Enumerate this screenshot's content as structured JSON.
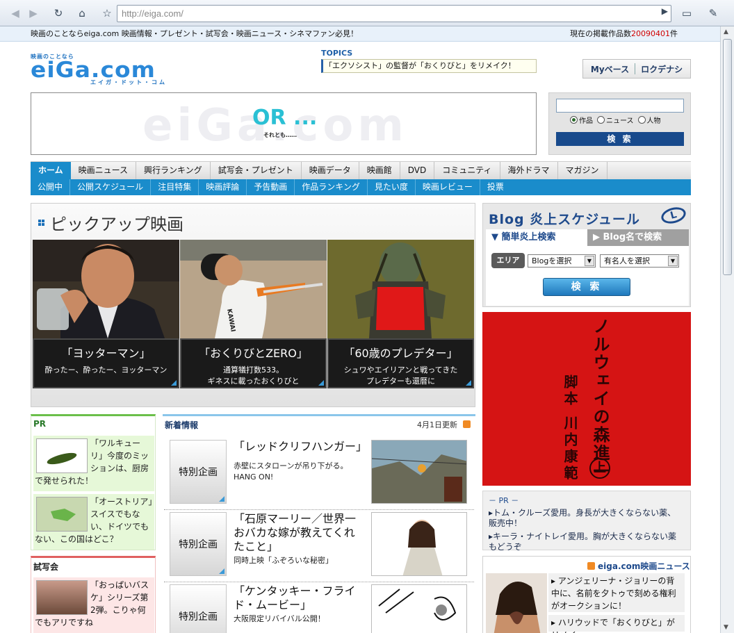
{
  "browser": {
    "url": "http://eiga.com/",
    "back_icon": "back-arrow-icon",
    "forward_icon": "forward-arrow-icon"
  },
  "infobar": {
    "left": "映画のことならeiga.com 映画情報・プレゼント・試写会・映画ニュース・シネマファン必見！",
    "right_prefix": "現在の掲載作品数",
    "right_value": "20090401",
    "right_suffix": "件"
  },
  "logo": {
    "top": "映画のことなら",
    "main": "eiGa.com",
    "sub": "エイガ・ドット・コム"
  },
  "topics": {
    "label": "TOPICS",
    "text": "「エクソシスト」の監督が「おくりびと」をリメイク！"
  },
  "user": {
    "mybase": "Myベース",
    "login": "ロクデナシ"
  },
  "banner": {
    "ghost": "eiGa.com",
    "main": "OR ...",
    "sub": "それとも……"
  },
  "search": {
    "opt1": "作品",
    "opt2": "ニュース",
    "opt3": "人物",
    "button": "検 索"
  },
  "mainnav": [
    "ホーム",
    "映画ニュース",
    "興行ランキング",
    "試写会・プレゼント",
    "映画データ",
    "映画館",
    "DVD",
    "コミュニティ",
    "海外ドラマ",
    "マガジン"
  ],
  "subnav": [
    "公開中",
    "公開スケジュール",
    "注目特集",
    "映画評論",
    "予告動画",
    "作品ランキング",
    "見たい度",
    "映画レビュー",
    "投票"
  ],
  "pickup": {
    "title": "ピックアップ映画",
    "cards": [
      {
        "title": "「ヨッターマン」",
        "line1": "酔ったー、酔ったー、ヨッターマン",
        "line2": ""
      },
      {
        "title": "「おくりびとZERO」",
        "line1": "通算犠打数533。",
        "line2": "ギネスに載ったおくりびと"
      },
      {
        "title": "「60歳のプレデター」",
        "line1": "シュワやエイリアンと戦ってきた",
        "line2": "プレデターも還暦に"
      }
    ],
    "card2_jersey": "KAWAI"
  },
  "pr": {
    "title": "PR",
    "items": [
      {
        "text": "「ワルキューリ」今度のミッションは、厨房で発せられた！"
      },
      {
        "text": "「オーストリア」スイスでもない、ドイツでもない、この国はどこ？"
      }
    ]
  },
  "shisha": {
    "title": "試写会",
    "text": "「おっぱいバスケ」シリーズ第2弾。こりゃ何でもアリですね"
  },
  "news": {
    "title": "新着情報",
    "updated": "4月1日更新",
    "items": [
      {
        "tag": "特別企画",
        "title": "「レッドクリフハンガー」",
        "desc": "赤壁にスタローンが吊り下がる。HANG ON!"
      },
      {
        "tag": "特別企画",
        "title": "「石原マーリー／世界一おバカな嫁が教えてくれたこと」",
        "desc": "同時上映「ふぞろいな秘密」"
      },
      {
        "tag": "特別企画",
        "title": "「ケンタッキー・フライド・ムービー」",
        "desc": "大阪限定リバイバル公開！"
      }
    ]
  },
  "blog": {
    "title": "Blog 炎上スケジュール",
    "tab1": "▼ 簡単炎上検索",
    "tab2": "▶ Blog名で検索",
    "area": "エリア",
    "select1": "Blogを選択",
    "select2": "有名人を選択",
    "button": "検 索"
  },
  "redad": {
    "line1": "ノルウェイの森進一",
    "circle": "上",
    "line2": "脚本 川内康範"
  },
  "pr2": {
    "title": "－ PR －",
    "items": [
      "トム・クルーズ愛用。身長が大きくならない薬、販売中！",
      "キーラ・ナイトレイ愛用。胸が大きくならない薬もどうぞ"
    ]
  },
  "enews": {
    "title": "eiga.com映画ニュース",
    "items": [
      "アンジェリーナ・ジョリーの背中に、名前を夕トゥで刻める権利がオークションに！",
      "ハリウッドで「おくりびと」がリメイ"
    ]
  }
}
